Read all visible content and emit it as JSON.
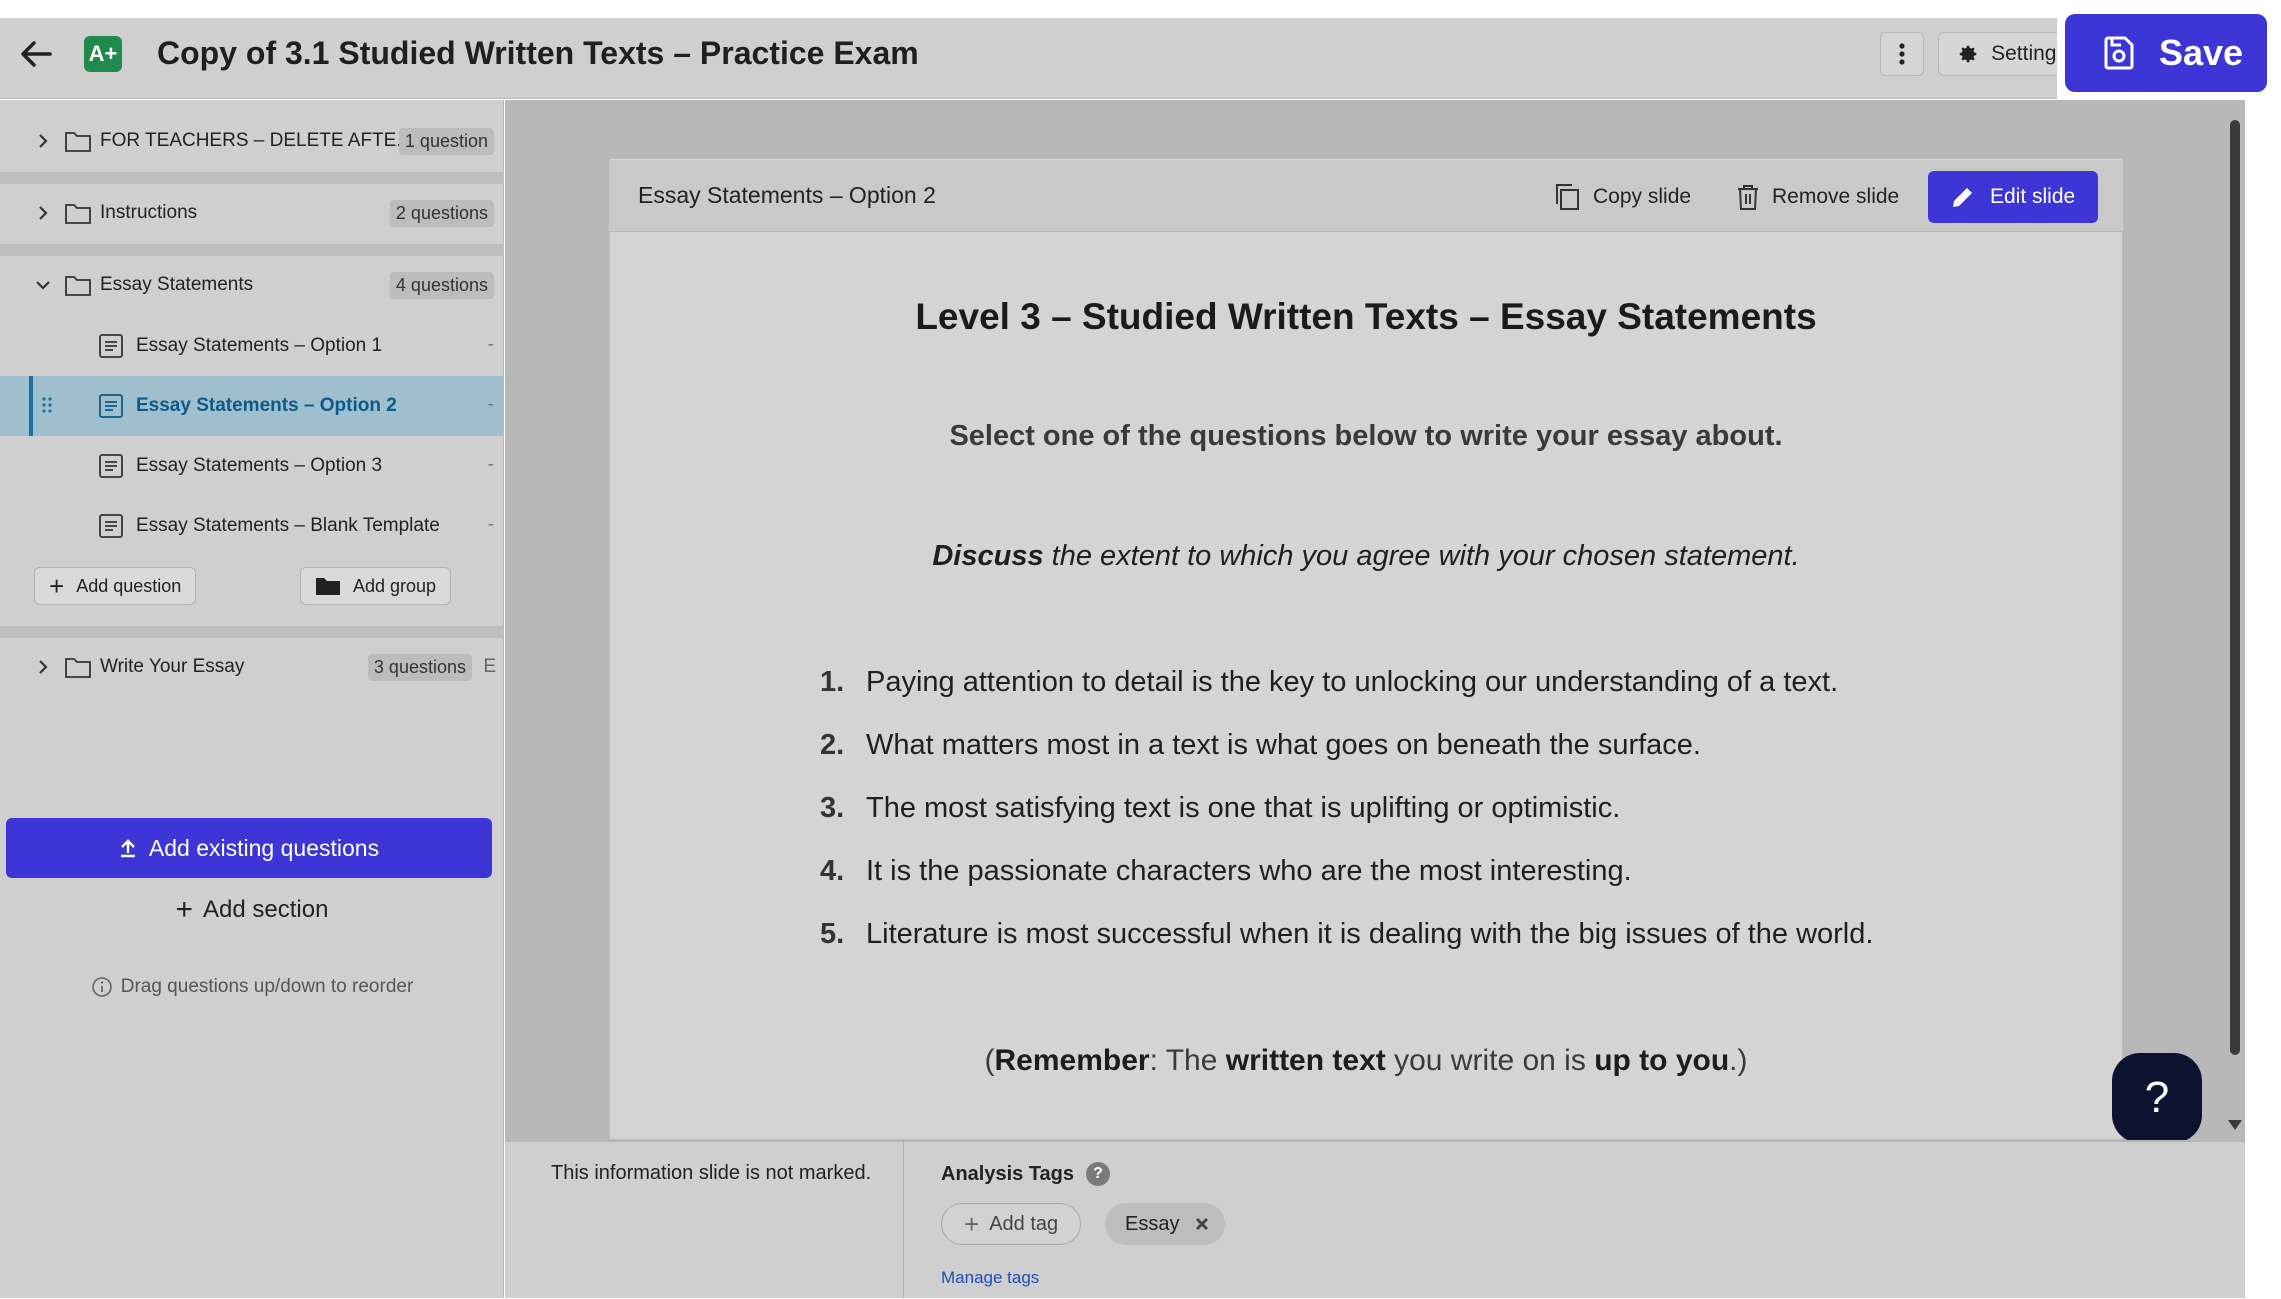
{
  "header": {
    "title": "Copy of 3.1 Studied Written Texts – Practice Exam",
    "logo_text": "A+",
    "settings_label": "Settings",
    "save_label": "Save",
    "accent_color": "#3d35d6"
  },
  "sidebar": {
    "sections": [
      {
        "label": "FOR TEACHERS – DELETE AFTE...",
        "count": "1 question",
        "expanded": false
      },
      {
        "label": "Instructions",
        "count": "2 questions",
        "expanded": false
      },
      {
        "label": "Essay Statements",
        "count": "4 questions",
        "expanded": true
      },
      {
        "label": "Write Your Essay",
        "count": "3 questions",
        "expanded": false,
        "trailing": "E"
      }
    ],
    "questions": [
      {
        "label": "Essay Statements – Option 1",
        "value": "-"
      },
      {
        "label": "Essay Statements – Option 2",
        "value": "-",
        "selected": true
      },
      {
        "label": "Essay Statements – Option 3",
        "value": "-"
      },
      {
        "label": "Essay Statements – Blank Template",
        "value": "-"
      }
    ],
    "add_question_label": "Add question",
    "add_group_label": "Add group",
    "add_existing_label": "Add existing questions",
    "add_section_label": "Add section",
    "drag_hint": "Drag questions up/down to reorder"
  },
  "slide": {
    "header_title": "Essay Statements – Option 2",
    "copy_label": "Copy slide",
    "remove_label": "Remove slide",
    "edit_label": "Edit slide",
    "heading": "Level 3 – Studied Written Texts – Essay Statements",
    "subheading": "Select one of the questions below to write your essay about.",
    "discuss_bold": "Discuss",
    "discuss_rest": " the extent to which you agree with your chosen statement.",
    "statements": [
      {
        "num": "1.",
        "text": "Paying attention to detail is the key to unlocking our understanding of a text."
      },
      {
        "num": "2.",
        "text": "What matters most in a text is what goes on beneath the surface."
      },
      {
        "num": "3.",
        "text": "The most satisfying text is one that is uplifting or optimistic."
      },
      {
        "num": "4.",
        "text": "It is the passionate characters who are the most interesting."
      },
      {
        "num": "5.",
        "text": "Literature is most successful when it is dealing with the big issues of the world."
      }
    ],
    "remember": {
      "p1": "(",
      "b1": "Remember",
      "p2": ": The ",
      "b2": "written text",
      "p3": " you write on is ",
      "b3": "up to you",
      "p4": ".)"
    }
  },
  "help_label": "?",
  "bottom": {
    "marked_note": "This information slide is not marked.",
    "tags_label": "Analysis Tags",
    "tags_help": "?",
    "add_tag_label": "Add tag",
    "tags": [
      "Essay"
    ],
    "manage_label": "Manage tags"
  }
}
